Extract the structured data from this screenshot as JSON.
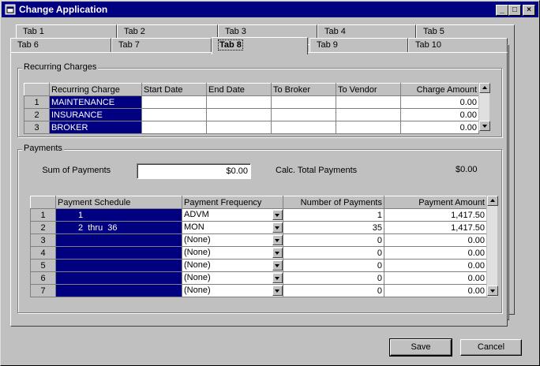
{
  "window": {
    "title": "Change Application"
  },
  "tabs_row_back": [
    "Tab 1",
    "Tab 2",
    "Tab 3",
    "Tab 4",
    "Tab 5"
  ],
  "tabs_row_front": [
    "Tab 6",
    "Tab 7",
    "Tab 8",
    "Tab 9",
    "Tab 10"
  ],
  "active_tab": "Tab 8",
  "recurring": {
    "label": "Recurring Charges",
    "columns": [
      "Recurring Charge",
      "Start Date",
      "End Date",
      "To Broker",
      "To Vendor",
      "Charge Amount"
    ],
    "rows": [
      {
        "n": "1",
        "charge": "MAINTENANCE",
        "amount": "0.00"
      },
      {
        "n": "2",
        "charge": "INSURANCE",
        "amount": "0.00"
      },
      {
        "n": "3",
        "charge": "BROKER",
        "amount": "0.00"
      }
    ]
  },
  "payments": {
    "label": "Payments",
    "sum_label": "Sum of Payments",
    "sum_value": "$0.00",
    "calc_label": "Calc. Total Payments",
    "calc_value": "$0.00",
    "columns": [
      "Payment Schedule",
      "Payment Frequency",
      "Number of Payments",
      "Payment Amount"
    ],
    "rows": [
      {
        "n": "1",
        "schedule": "1",
        "freq": "ADVM",
        "count": "1",
        "amount": "1,417.50"
      },
      {
        "n": "2",
        "schedule": "2  thru  36",
        "freq": "MON",
        "count": "35",
        "amount": "1,417.50"
      },
      {
        "n": "3",
        "schedule": "",
        "freq": "(None)",
        "count": "0",
        "amount": "0.00"
      },
      {
        "n": "4",
        "schedule": "",
        "freq": "(None)",
        "count": "0",
        "amount": "0.00"
      },
      {
        "n": "5",
        "schedule": "",
        "freq": "(None)",
        "count": "0",
        "amount": "0.00"
      },
      {
        "n": "6",
        "schedule": "",
        "freq": "(None)",
        "count": "0",
        "amount": "0.00"
      },
      {
        "n": "7",
        "schedule": "",
        "freq": "(None)",
        "count": "0",
        "amount": "0.00"
      }
    ]
  },
  "buttons": {
    "save": "Save",
    "cancel": "Cancel"
  }
}
